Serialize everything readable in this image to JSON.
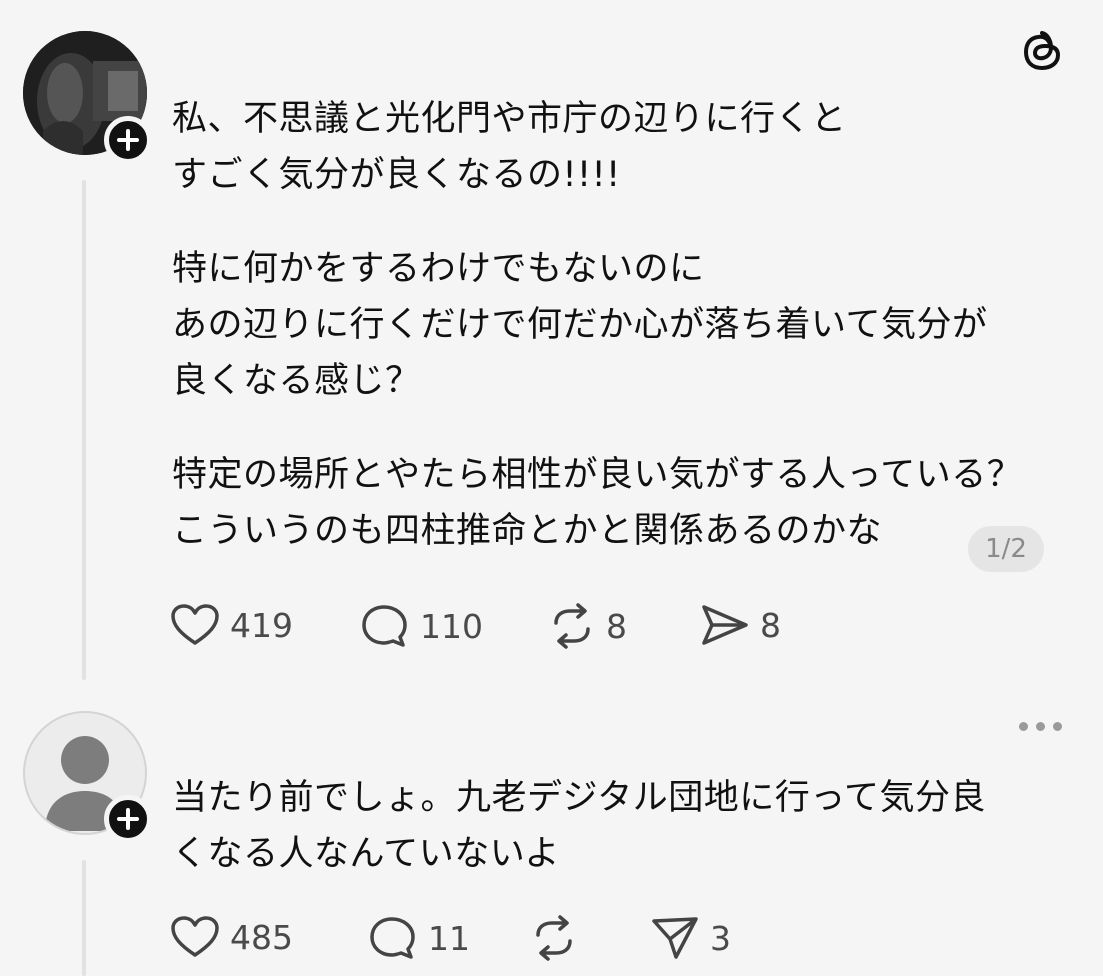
{
  "post": {
    "paragraphs": [
      "私、不思議と光化門や市庁の辺りに行くと\nすごく気分が良くなるの!!!!",
      "特に何かをするわけでもないのに\nあの辺りに行くだけで何だか心が落ち着いて気分が\n良くなる感じ？",
      "特定の場所とやたら相性が良い気がする人っている？\nこういうのも四柱推命とかと関係あるのかな"
    ],
    "page_indicator": "1/2",
    "actions": {
      "likes": "419",
      "replies": "110",
      "reposts": "8",
      "shares": "8"
    }
  },
  "reply": {
    "text": "当たり前でしょ。九老デジタル団地に行って気分良\nくなる人なんていないよ",
    "actions": {
      "likes": "485",
      "replies": "11",
      "reposts": "",
      "shares": "3"
    }
  },
  "icons": {
    "app_logo": "threads-logo-icon",
    "follow": "plus-icon",
    "like": "heart-icon",
    "reply": "speech-bubble-icon",
    "repost": "repost-icon",
    "share": "send-icon",
    "more": "more-horizontal-icon"
  },
  "colors": {
    "background": "#f5f5f5",
    "text": "#111111",
    "secondary_text": "#4a4a4a",
    "thread_line": "#e2e2e2"
  }
}
